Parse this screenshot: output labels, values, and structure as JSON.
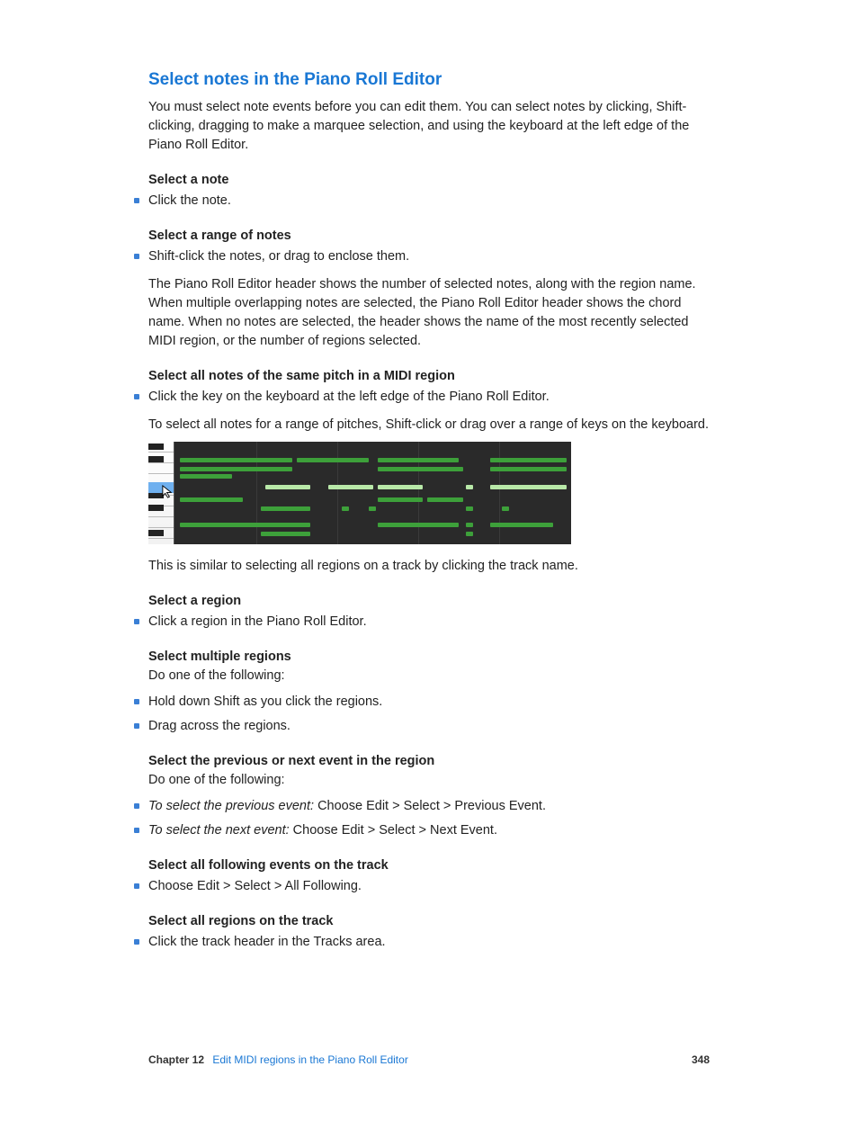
{
  "title": "Select notes in the Piano Roll Editor",
  "intro": "You must select note events before you can edit them. You can select notes by clicking, Shift-clicking, dragging to make a marquee selection, and using the keyboard at the left edge of the Piano Roll Editor.",
  "sections": {
    "sel_note": {
      "head": "Select a note",
      "b0": "Click the note."
    },
    "sel_range": {
      "head": "Select a range of notes",
      "b0": "Shift-click the notes, or drag to enclose them.",
      "after": "The Piano Roll Editor header shows the number of selected notes, along with the region name. When multiple overlapping notes are selected, the Piano Roll Editor header shows the chord name. When no notes are selected, the header shows the name of the most recently selected MIDI region, or the number of regions selected."
    },
    "sel_pitch": {
      "head": "Select all notes of the same pitch in a MIDI region",
      "b0": "Click the key on the keyboard at the left edge of the Piano Roll Editor.",
      "after1": "To select all notes for a range of pitches, Shift-click or drag over a range of keys on the keyboard.",
      "after2": "This is similar to selecting all regions on a track by clicking the track name."
    },
    "sel_region": {
      "head": "Select a region",
      "b0": "Click a region in the Piano Roll Editor."
    },
    "sel_multi": {
      "head": "Select multiple regions",
      "sub": "Do one of the following:",
      "b0": "Hold down Shift as you click the regions.",
      "b1": "Drag across the regions."
    },
    "sel_prevnext": {
      "head": "Select the previous or next event in the region",
      "sub": "Do one of the following:",
      "b0_label": "To select the previous event:",
      "b0_rest": " Choose Edit > Select > Previous Event.",
      "b1_label": "To select the next event:",
      "b1_rest": " Choose Edit > Select > Next Event."
    },
    "sel_following": {
      "head": "Select all following events on the track",
      "b0": "Choose Edit > Select > All Following."
    },
    "sel_allreg": {
      "head": "Select all regions on the track",
      "b0": "Click the track header in the Tracks area."
    }
  },
  "footer": {
    "chapter_label": "Chapter  12",
    "chapter_title": "Edit MIDI regions in the Piano Roll Editor",
    "page": "348"
  }
}
